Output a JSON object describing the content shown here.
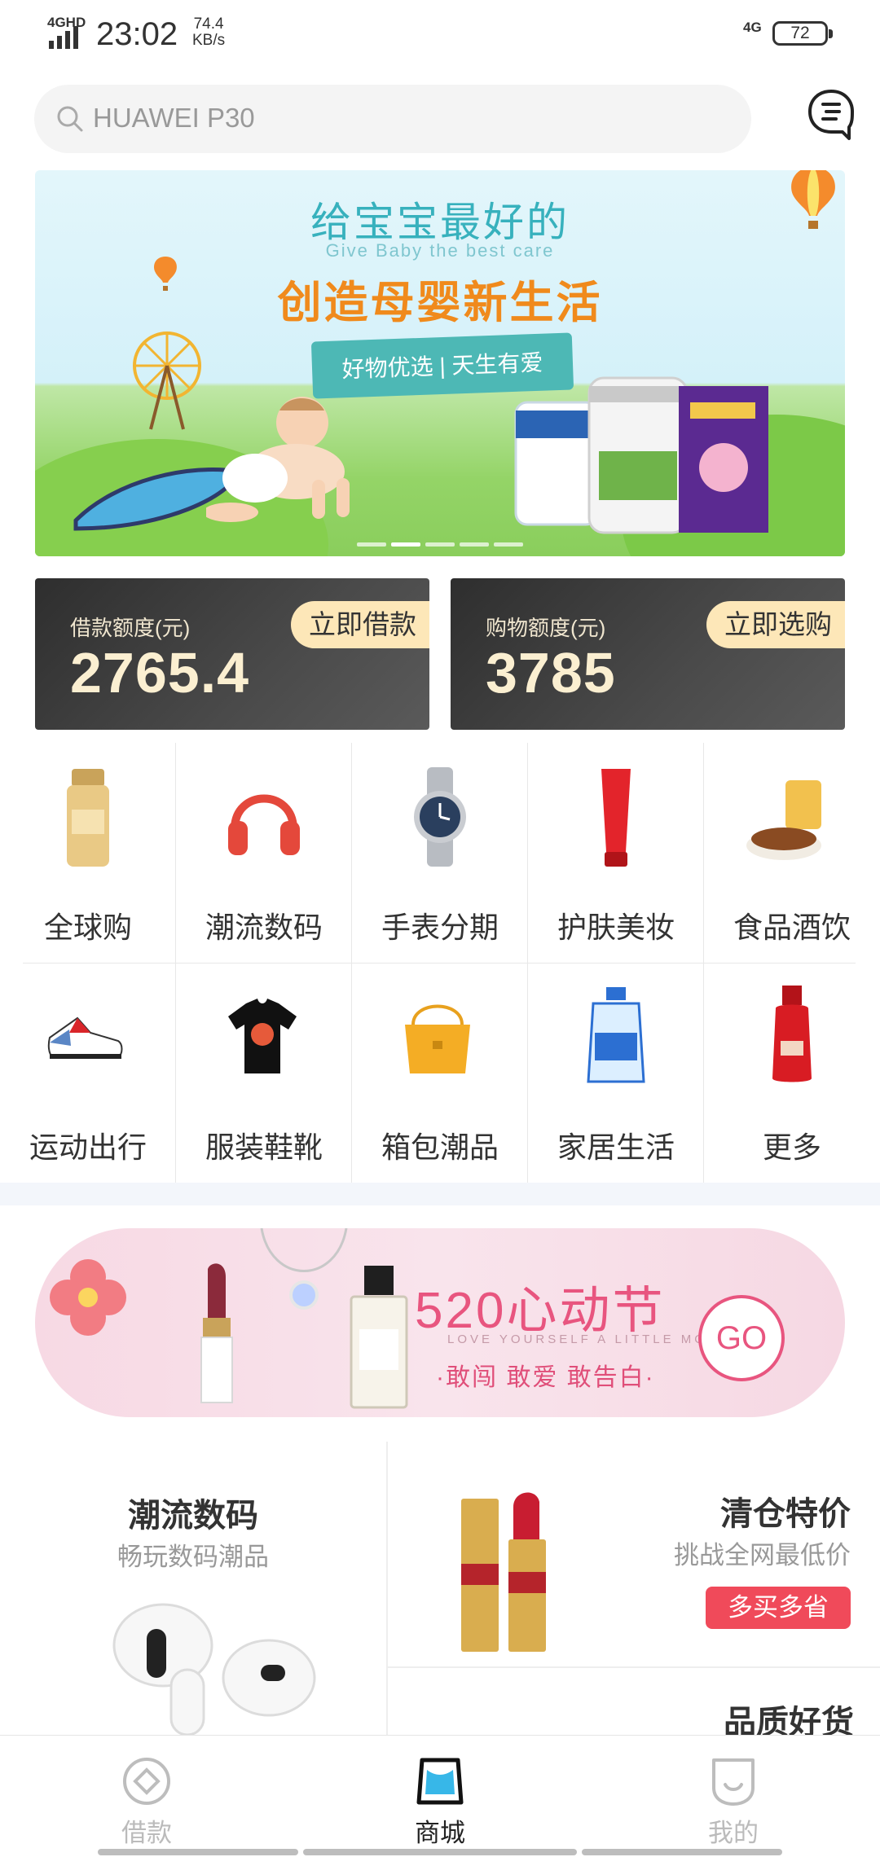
{
  "status_bar": {
    "network": "4GHD",
    "time": "23:02",
    "speed_value": "74.4",
    "speed_unit": "KB/s",
    "network_right": "4G",
    "battery": "72"
  },
  "search": {
    "placeholder": "HUAWEI P30"
  },
  "banner": {
    "title": "给宝宝最好的",
    "subtitle": "Give Baby the best care",
    "main": "创造母婴新生活",
    "ribbon": "好物优选 | 天生有爱",
    "page_count": 5,
    "active_page": 2
  },
  "credit": {
    "loan": {
      "label": "借款额度(元)",
      "amount": "2765.4",
      "button": "立即借款"
    },
    "shopping": {
      "label": "购物额度(元)",
      "amount": "3785",
      "button": "立即选购"
    }
  },
  "categories": [
    {
      "label": "全球购",
      "icon": "sunscreen-icon"
    },
    {
      "label": "潮流数码",
      "icon": "headphones-icon"
    },
    {
      "label": "手表分期",
      "icon": "watch-icon"
    },
    {
      "label": "护肤美妆",
      "icon": "cosmetic-tube-icon"
    },
    {
      "label": "食品酒饮",
      "icon": "snack-bowl-icon"
    },
    {
      "label": "运动出行",
      "icon": "sneaker-icon"
    },
    {
      "label": "服装鞋靴",
      "icon": "tshirt-icon"
    },
    {
      "label": "箱包潮品",
      "icon": "handbag-icon"
    },
    {
      "label": "家居生活",
      "icon": "detergent-icon"
    },
    {
      "label": "更多",
      "icon": "serum-bottle-icon"
    }
  ],
  "promo": {
    "title": "520心动节",
    "english": "LOVE YOURSELF A LITTLE MORE",
    "sub": "·敢闯 敢爱 敢告白·",
    "go": "GO"
  },
  "features": {
    "digital": {
      "title": "潮流数码",
      "sub": "畅玩数码潮品"
    },
    "clearance": {
      "title": "清仓特价",
      "sub": "挑战全网最低价",
      "tag": "多买多省"
    },
    "quality": {
      "title": "品质好货"
    }
  },
  "tabs": [
    {
      "label": "借款",
      "active": false
    },
    {
      "label": "商城",
      "active": true
    },
    {
      "label": "我的",
      "active": false
    }
  ],
  "colors": {
    "accent_gold": "#fde7b8",
    "card_dark": "#3a3a3a",
    "promo_pink": "#e8557f",
    "tag_red": "#f04a5a"
  }
}
